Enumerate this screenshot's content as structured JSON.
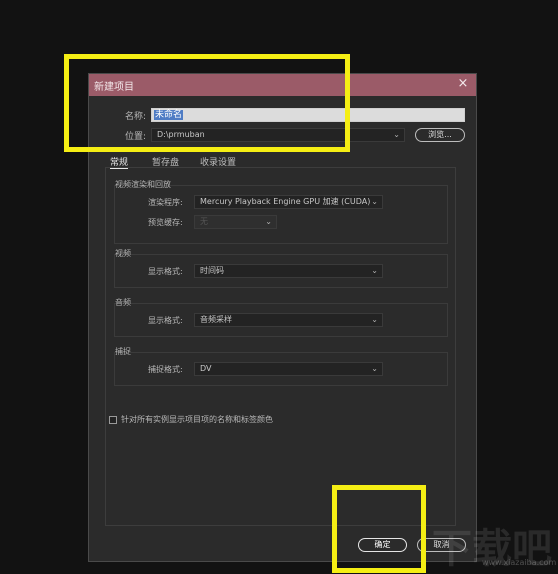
{
  "dialog": {
    "title": "新建项目",
    "close_glyph": "×",
    "name_label": "名称:",
    "name_value": "未命名",
    "location_label": "位置:",
    "location_value": "D:\\prmuban",
    "browse_label": "浏览..."
  },
  "tabs": [
    {
      "label": "常规",
      "active": true
    },
    {
      "label": "暂存盘",
      "active": false
    },
    {
      "label": "收录设置",
      "active": false
    }
  ],
  "groups": {
    "render": {
      "title": "视频渲染和回放",
      "renderer_label": "渲染程序:",
      "renderer_value": "Mercury Playback Engine GPU 加速 (CUDA)",
      "preview_cache_label": "预览缓存:",
      "preview_cache_value": "无"
    },
    "video": {
      "title": "视频",
      "display_format_label": "显示格式:",
      "display_format_value": "时间码"
    },
    "audio": {
      "title": "音频",
      "display_format_label": "显示格式:",
      "display_format_value": "音频采样"
    },
    "capture": {
      "title": "捕捉",
      "capture_format_label": "捕捉格式:",
      "capture_format_value": "DV"
    }
  },
  "checkbox_label": "针对所有实例显示项目项的名称和标签颜色",
  "checkbox_checked": false,
  "buttons": {
    "ok": "确定",
    "cancel": "取消"
  },
  "icons": {
    "dropdown": "chevron-down-icon",
    "close": "close-icon"
  },
  "watermark": {
    "text": "下载吧",
    "url": "www.xiazaiba.com"
  },
  "colors": {
    "titlebar": "#9b5b68",
    "highlight": "#f5ee14",
    "dialog_bg": "#2b2b2b"
  }
}
